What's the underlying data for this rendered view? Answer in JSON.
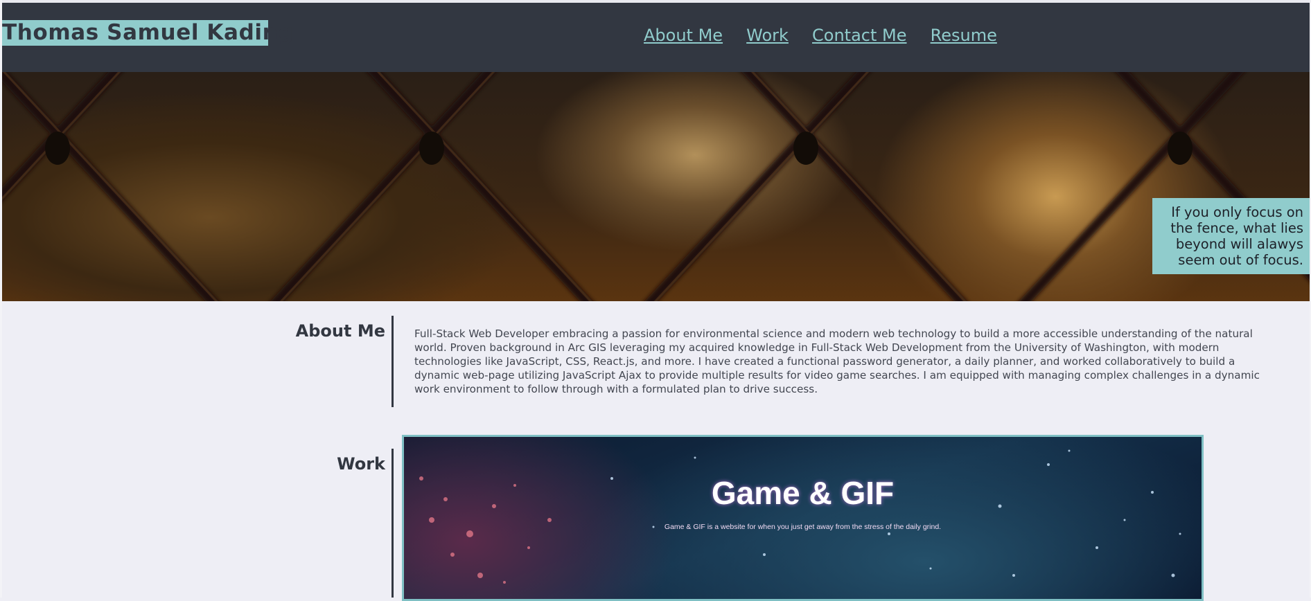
{
  "header": {
    "brand": "Thomas Samuel Kading",
    "nav": [
      "About Me",
      "Work",
      "Contact Me",
      "Resume"
    ]
  },
  "hero": {
    "quote": "If you only focus on the fence, what lies beyond will alawys seem out of focus."
  },
  "about": {
    "title": "About Me",
    "text": "Full-Stack Web Developer embracing a passion for environmental science and modern web technology to build a more accessible understanding of the natural world. Proven background in Arc GIS leveraging my acquired knowledge in Full-Stack Web Development from the University of Washington, with modern technologies like JavaScript, CSS, React.js, and more. I have created a functional password generator, a daily planner, and worked collaboratively to build a dynamic web-page utilizing JavaScript Ajax to provide multiple results for video game searches. I am equipped with managing complex challenges in a dynamic work environment to follow through with a formulated plan to drive success."
  },
  "work": {
    "title": "Work",
    "project": {
      "title": "Game & GIF",
      "subtitle": "Game & GIF is a website for when you just get away from the stress of the daily grind."
    }
  },
  "colors": {
    "header_bg": "#323741",
    "accent": "#90cccc",
    "page_bg": "#eeeef5",
    "text_dark": "#323741"
  }
}
